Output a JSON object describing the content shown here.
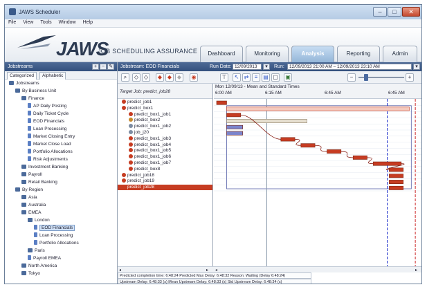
{
  "window": {
    "title": "JAWS Scheduler",
    "min": "–",
    "max": "□",
    "close": "✕"
  },
  "menu": [
    "File",
    "View",
    "Tools",
    "Window",
    "Help"
  ],
  "banner": {
    "logo": "JAWS",
    "tagline": "JOB SCHEDULING ASSURANCE"
  },
  "nav_tabs": [
    "Dashboard",
    "Monitoring",
    "Analysis",
    "Reporting",
    "Admin"
  ],
  "active_tab": "Analysis",
  "sidebar": {
    "header": "Jobstreams",
    "tabs": [
      "Categorized",
      "Alphabetic"
    ],
    "tree": [
      {
        "label": "Jobstreams",
        "depth": 0,
        "icon": "folder-icon"
      },
      {
        "label": "By Business Unit",
        "depth": 1,
        "icon": "book-icon"
      },
      {
        "label": "Finance",
        "depth": 2,
        "icon": "book-icon"
      },
      {
        "label": "AP Daily Posting",
        "depth": 3,
        "icon": "job-icon"
      },
      {
        "label": "Daily Ticket Cycle",
        "depth": 3,
        "icon": "job-icon"
      },
      {
        "label": "EOD Financials",
        "depth": 3,
        "icon": "job-icon"
      },
      {
        "label": "Loan Processing",
        "depth": 3,
        "icon": "job-icon"
      },
      {
        "label": "Market Closing Entry",
        "depth": 3,
        "icon": "job-icon"
      },
      {
        "label": "Market Close Load",
        "depth": 3,
        "icon": "job-icon"
      },
      {
        "label": "Portfolio Allocations",
        "depth": 3,
        "icon": "job-icon"
      },
      {
        "label": "Risk Adjustments",
        "depth": 3,
        "icon": "job-icon"
      },
      {
        "label": "Investment Banking",
        "depth": 2,
        "icon": "book-icon"
      },
      {
        "label": "Payroll",
        "depth": 2,
        "icon": "book-icon"
      },
      {
        "label": "Retail Banking",
        "depth": 2,
        "icon": "book-icon"
      },
      {
        "label": "By Region",
        "depth": 1,
        "icon": "book-icon"
      },
      {
        "label": "Asia",
        "depth": 2,
        "icon": "book-icon"
      },
      {
        "label": "Australia",
        "depth": 2,
        "icon": "book-icon"
      },
      {
        "label": "EMEA",
        "depth": 2,
        "icon": "book-icon"
      },
      {
        "label": "London",
        "depth": 3,
        "icon": "book-icon"
      },
      {
        "label": "EOD Financials",
        "depth": 4,
        "icon": "job-icon",
        "selected": true
      },
      {
        "label": "Loan Processing",
        "depth": 4,
        "icon": "job-icon"
      },
      {
        "label": "Portfolio Allocations",
        "depth": 4,
        "icon": "job-icon"
      },
      {
        "label": "Paris",
        "depth": 3,
        "icon": "book-icon"
      },
      {
        "label": "Payroll EMEA",
        "depth": 3,
        "icon": "job-icon"
      },
      {
        "label": "North America",
        "depth": 2,
        "icon": "book-icon"
      },
      {
        "label": "Tokyo",
        "depth": 2,
        "icon": "book-icon"
      }
    ]
  },
  "main": {
    "header": "Jobstream: EOD Financials",
    "run_date_label": "Run Date:",
    "run_date": "12/09/2013",
    "run_label": "Run:",
    "run_value": "12/09/2013 21:00 AM – 12/09/2013 23:10 AM",
    "joblist_header": "Target Job: predict_job28",
    "gantt_header": "Mon 12/09/13 - Mean and Standard Times",
    "times": [
      "6:00 AM",
      "6:15 AM",
      "6:45 AM",
      "6:45 AM"
    ],
    "jobs": [
      {
        "label": "predict_job1",
        "depth": 0,
        "color": "#c63c22"
      },
      {
        "label": "predict_box1",
        "depth": 0,
        "color": "#c63c22"
      },
      {
        "label": "predict_box1_job1",
        "depth": 1,
        "color": "#c63c22"
      },
      {
        "label": "predict_box2",
        "depth": 1,
        "color": "#c88a2c"
      },
      {
        "label": "predict_box1_job2",
        "depth": 1,
        "color": "#7d8ca2"
      },
      {
        "label": "job_j20",
        "depth": 1,
        "color": "#7d8ca2"
      },
      {
        "label": "predict_box1_job3",
        "depth": 1,
        "color": "#c63c22"
      },
      {
        "label": "predict_box1_job4",
        "depth": 1,
        "color": "#c63c22"
      },
      {
        "label": "predict_box1_job5",
        "depth": 1,
        "color": "#c63c22"
      },
      {
        "label": "predict_box1_job6",
        "depth": 1,
        "color": "#c63c22"
      },
      {
        "label": "predict_box1_job7",
        "depth": 1,
        "color": "#c63c22"
      },
      {
        "label": "predict_box8",
        "depth": 1,
        "color": "#c63c22"
      },
      {
        "label": "predict_job18",
        "depth": 0,
        "color": "#c63c22"
      },
      {
        "label": "predict_job19",
        "depth": 0,
        "color": "#c63c22"
      },
      {
        "label": "predict_job28",
        "depth": 0,
        "color": "#c63c22",
        "selected": true
      }
    ],
    "status1": "Predicted completion time: 6:48:24  Predicted Max Delay: 6:48:32  Reason: Waiting (Delay 6:48:24)",
    "status2": "Upstream Delay: 6:48:33 (s) Mean Upstream Delay: 6:48:33 (s)  Std Upstream Delay: 6:48:34 (s)"
  },
  "chart_data": {
    "type": "gantt",
    "title": "Mon 12/09/13 - Mean and Standard Times",
    "x_ticks": [
      "6:00 AM",
      "6:15 AM",
      "6:45 AM",
      "6:45 AM"
    ],
    "bars": [
      {
        "job": "predict_job1",
        "start": 0.0,
        "end": 0.05,
        "color": "#c63c22"
      },
      {
        "job": "predict_box1",
        "start": 0.05,
        "end": 0.96,
        "color": "#f4c9bd",
        "outline": "#c63c22"
      },
      {
        "job": "predict_box1_job1",
        "start": 0.05,
        "end": 0.12,
        "color": "#c63c22"
      },
      {
        "job": "predict_box2",
        "start": 0.05,
        "end": 0.45,
        "color": "#e6dfd0",
        "outline": "#8a7d66"
      },
      {
        "job": "predict_box1_job2",
        "start": 0.05,
        "end": 0.13,
        "color": "#7b84cc"
      },
      {
        "job": "job_j20",
        "start": 0.05,
        "end": 0.13,
        "color": "#7b84cc"
      },
      {
        "job": "predict_box1_job3",
        "start": 0.32,
        "end": 0.39,
        "color": "#c63c22"
      },
      {
        "job": "predict_box1_job4",
        "start": 0.42,
        "end": 0.49,
        "color": "#c63c22"
      },
      {
        "job": "predict_box1_job5",
        "start": 0.55,
        "end": 0.62,
        "color": "#c63c22"
      },
      {
        "job": "predict_box1_job6",
        "start": 0.68,
        "end": 0.75,
        "color": "#c63c22"
      },
      {
        "job": "predict_box1_job7",
        "start": 0.78,
        "end": 0.92,
        "color": "#c63c22"
      },
      {
        "job": "predict_box8",
        "start": 0.86,
        "end": 0.93,
        "color": "#c63c22"
      },
      {
        "job": "predict_job18",
        "start": 0.86,
        "end": 0.93,
        "color": "#c63c22"
      },
      {
        "job": "predict_job19",
        "start": 0.86,
        "end": 0.93,
        "color": "#c63c22"
      },
      {
        "job": "predict_job28",
        "start": 0.86,
        "end": 0.93,
        "color": "#c63c22"
      }
    ],
    "markers": [
      {
        "at": 0.25,
        "color": "#8899aa",
        "style": "solid"
      },
      {
        "at": 0.85,
        "color": "#2233cc",
        "style": "dashed"
      },
      {
        "at": 0.99,
        "color": "#cc2222",
        "style": "dashed"
      }
    ]
  }
}
